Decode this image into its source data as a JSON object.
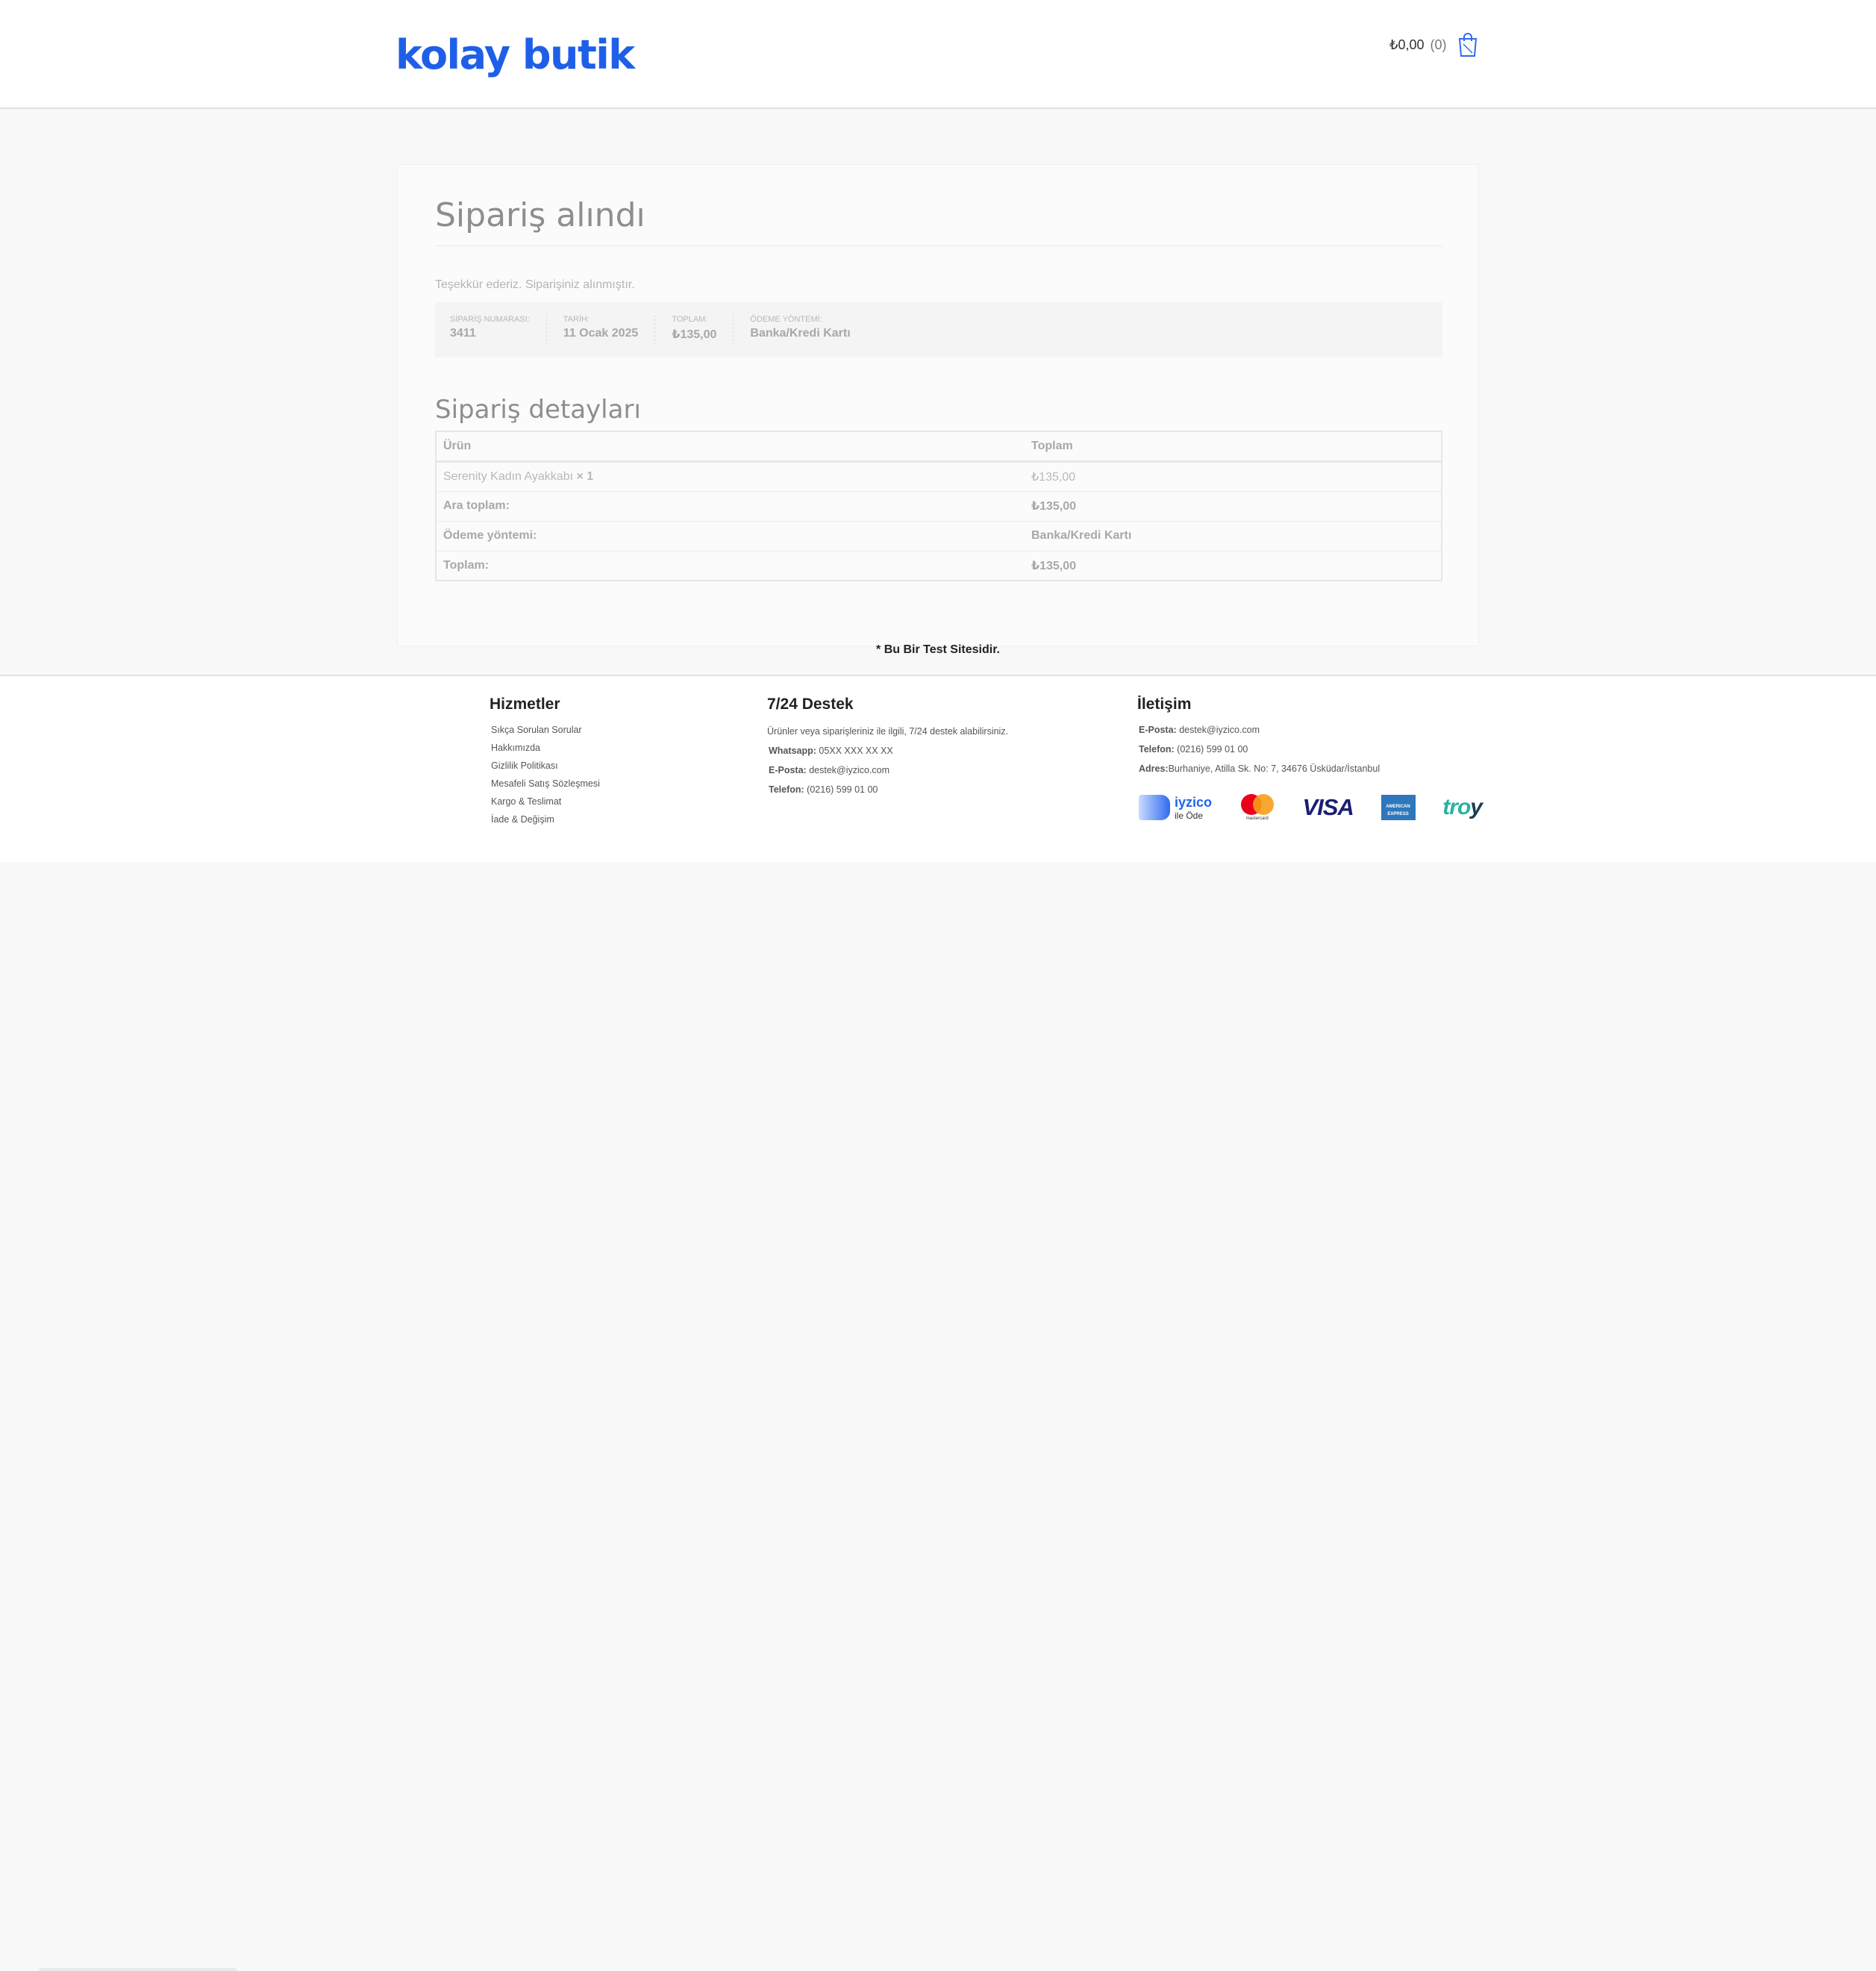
{
  "header": {
    "logo_text": "kolay butik",
    "cart_total": "₺0,00",
    "cart_count": "(0)"
  },
  "order": {
    "title": "Sipariş alındı",
    "thanks": "Teşekkür ederiz. Siparişiniz alınmıştır.",
    "overview": [
      {
        "label": "SİPARİŞ NUMARASI:",
        "value": "3411"
      },
      {
        "label": "TARİH:",
        "value": "11 Ocak 2025"
      },
      {
        "label": "TOPLAM:",
        "value": "₺135,00"
      },
      {
        "label": "ÖDEME YÖNTEMİ:",
        "value": "Banka/Kredi Kartı"
      }
    ],
    "details_title": "Sipariş detayları",
    "table": {
      "headers": [
        "Ürün",
        "Toplam"
      ],
      "item": {
        "name": "Serenity Kadın Ayakkabı",
        "qty": "× 1",
        "total": "₺135,00"
      },
      "rows": [
        {
          "label": "Ara toplam:",
          "value": "₺135,00"
        },
        {
          "label": "Ödeme yöntemi:",
          "value": "Banka/Kredi Kartı"
        },
        {
          "label": "Toplam:",
          "value": "₺135,00"
        }
      ]
    }
  },
  "test_note": "* Bu Bir Test Sitesidir.",
  "footer": {
    "services": {
      "heading": "Hizmetler",
      "links": [
        "Sıkça Sorulan Sorular",
        "Hakkımızda",
        "Gizlilik Politikası",
        "Mesafeli Satış Sözleşmesi",
        "Kargo & Teslimat",
        "İade & Değişim"
      ]
    },
    "support": {
      "heading": "7/24 Destek",
      "intro": "Ürünler veya siparişleriniz ile ilgili, 7/24 destek alabilirsiniz.",
      "whatsapp_label": "Whatsapp:",
      "whatsapp": "05XX XXX XX XX",
      "email_label": "E-Posta:",
      "email": "destek@iyzico.com",
      "phone_label": "Telefon:",
      "phone": "(0216) 599 01 00"
    },
    "contact": {
      "heading": "İletişim",
      "email_label": "E-Posta:",
      "email": "destek@iyzico.com",
      "phone_label": "Telefon:",
      "phone": "(0216) 599 01 00",
      "address_label": "Adres:",
      "address": "Burhaniye, Atilla Sk. No: 7, 34676 Üsküdar/İstanbul"
    },
    "payments": {
      "iyzico_brand": "iyzico",
      "iyzico_sub": "ile Öde",
      "mastercard_word": "mastercard",
      "visa": "VISA",
      "amex": "AMERICAN EXPRESS",
      "troy_a": "tr",
      "troy_b": "o",
      "troy_c": "y"
    }
  },
  "colors": {
    "brand": "#1f5fe8",
    "background": "#f8f8f8",
    "muted_text": "#a8a8a8"
  }
}
